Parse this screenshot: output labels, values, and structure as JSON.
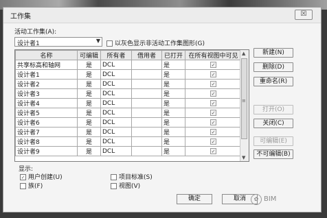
{
  "dialog": {
    "title": "工作集",
    "close_glyph": "☒"
  },
  "active_workset": {
    "label": "活动工作集(A):",
    "value": "设计者1",
    "arrow": "▼",
    "gray_option_label": "以灰色显示非活动工作集图形(G)",
    "gray_option_checked": false
  },
  "table": {
    "columns": [
      "名称",
      "可编辑",
      "所有者",
      "借用者",
      "已打开",
      "在所有视图中可见"
    ],
    "rows": [
      {
        "name": "共享标高和轴网",
        "editable": "是",
        "owner": "DCL",
        "borrower": "",
        "opened": "是",
        "visible": true
      },
      {
        "name": "设计者1",
        "editable": "是",
        "owner": "DCL",
        "borrower": "",
        "opened": "是",
        "visible": true
      },
      {
        "name": "设计者2",
        "editable": "是",
        "owner": "DCL",
        "borrower": "",
        "opened": "是",
        "visible": true
      },
      {
        "name": "设计者3",
        "editable": "是",
        "owner": "DCL",
        "borrower": "",
        "opened": "是",
        "visible": true
      },
      {
        "name": "设计者4",
        "editable": "是",
        "owner": "DCL",
        "borrower": "",
        "opened": "是",
        "visible": true
      },
      {
        "name": "设计者5",
        "editable": "是",
        "owner": "DCL",
        "borrower": "",
        "opened": "是",
        "visible": true
      },
      {
        "name": "设计者6",
        "editable": "是",
        "owner": "DCL",
        "borrower": "",
        "opened": "是",
        "visible": true
      },
      {
        "name": "设计者7",
        "editable": "是",
        "owner": "DCL",
        "borrower": "",
        "opened": "是",
        "visible": true
      },
      {
        "name": "设计者8",
        "editable": "是",
        "owner": "DCL",
        "borrower": "",
        "opened": "是",
        "visible": true
      },
      {
        "name": "设计者9",
        "editable": "是",
        "owner": "DCL",
        "borrower": "",
        "opened": "是",
        "visible": true
      }
    ]
  },
  "side_buttons": {
    "new": "新建(N)",
    "delete": "删除(D)",
    "rename": "重命名(R)",
    "open": "打开(O)",
    "close": "关闭(C)",
    "editable": "可编辑(E)",
    "not_editable": "不可编辑(B)"
  },
  "show": {
    "label": "显示:",
    "user_created": {
      "label": "用户创建(U)",
      "checked": true
    },
    "families": {
      "label": "族(F)",
      "checked": false
    },
    "project_standards": {
      "label": "项目标准(S)",
      "checked": false
    },
    "views": {
      "label": "视图(V)",
      "checked": false
    }
  },
  "footer": {
    "ok": "确定",
    "cancel": "取消",
    "watermark": "BIM"
  },
  "glyphs": {
    "check": "✓",
    "scroll_up": "▲",
    "scroll_down": "▼",
    "grip": "≡"
  }
}
